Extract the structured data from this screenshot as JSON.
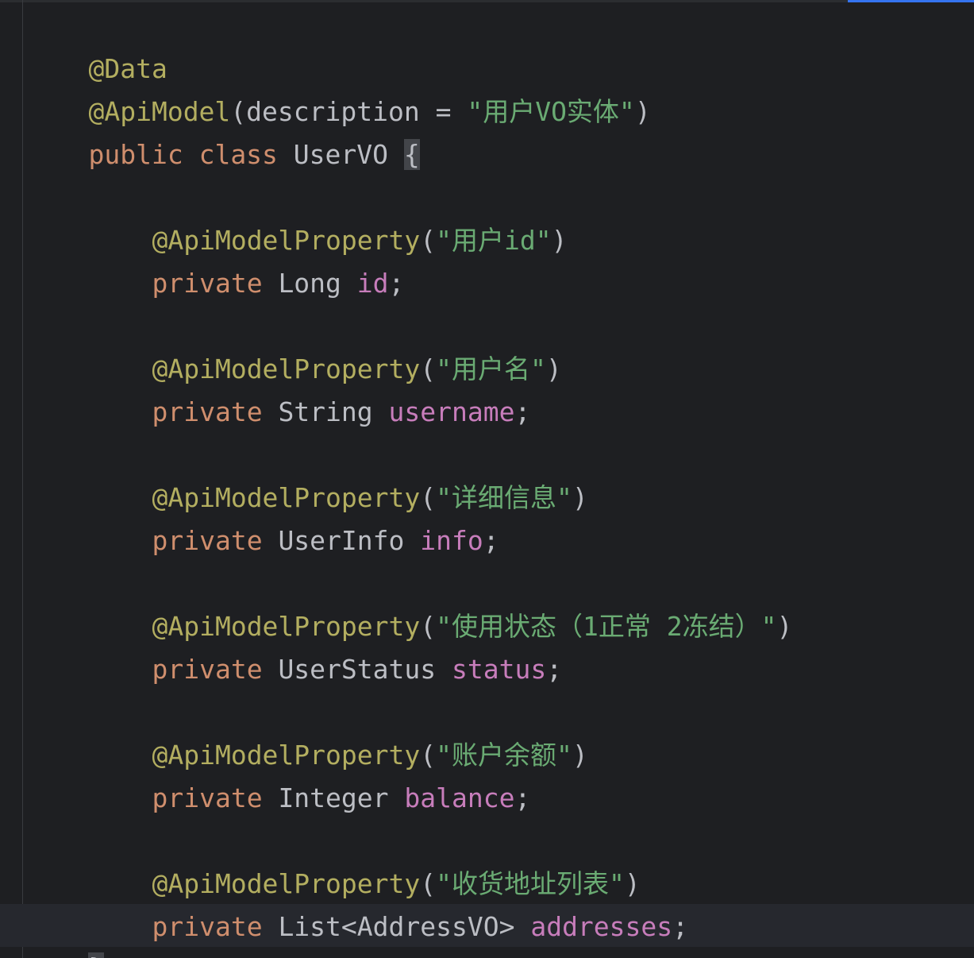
{
  "editor": {
    "line1": {
      "annotation": "@Data"
    },
    "line2": {
      "annotation": "@ApiModel",
      "paren_open": "(",
      "param": "description",
      "equals": " = ",
      "string": "\"用户VO实体\"",
      "paren_close": ")"
    },
    "line3": {
      "kw_public": "public",
      "kw_class": "class",
      "class_name": "UserVO",
      "brace_open": "{"
    },
    "fields": [
      {
        "annotation": "@ApiModelProperty",
        "paren_open": "(",
        "string": "\"用户id\"",
        "paren_close": ")",
        "kw": "private",
        "type": "Long",
        "name": "id",
        "semicolon": ";"
      },
      {
        "annotation": "@ApiModelProperty",
        "paren_open": "(",
        "string": "\"用户名\"",
        "paren_close": ")",
        "kw": "private",
        "type": "String",
        "name": "username",
        "semicolon": ";"
      },
      {
        "annotation": "@ApiModelProperty",
        "paren_open": "(",
        "string": "\"详细信息\"",
        "paren_close": ")",
        "kw": "private",
        "type": "UserInfo",
        "name": "info",
        "semicolon": ";"
      },
      {
        "annotation": "@ApiModelProperty",
        "paren_open": "(",
        "string": "\"使用状态（1正常 2冻结）\"",
        "paren_close": ")",
        "kw": "private",
        "type": "UserStatus",
        "name": "status",
        "semicolon": ";"
      },
      {
        "annotation": "@ApiModelProperty",
        "paren_open": "(",
        "string": "\"账户余额\"",
        "paren_close": ")",
        "kw": "private",
        "type": "Integer",
        "name": "balance",
        "semicolon": ";"
      },
      {
        "annotation": "@ApiModelProperty",
        "paren_open": "(",
        "string": "\"收货地址列表\"",
        "paren_close": ")",
        "kw": "private",
        "type": "List<AddressVO>",
        "name": "addresses",
        "semicolon": ";"
      }
    ],
    "closing": {
      "brace_close": "}"
    }
  },
  "theme": {
    "background": "#1e1f22",
    "caret_line": "#26282e",
    "annotation": "#b3ae60",
    "keyword": "#cf8e6d",
    "string": "#6aab73",
    "field": "#c77dbb",
    "plain": "#bcbec4",
    "tab_indicator": "#3574f0"
  }
}
